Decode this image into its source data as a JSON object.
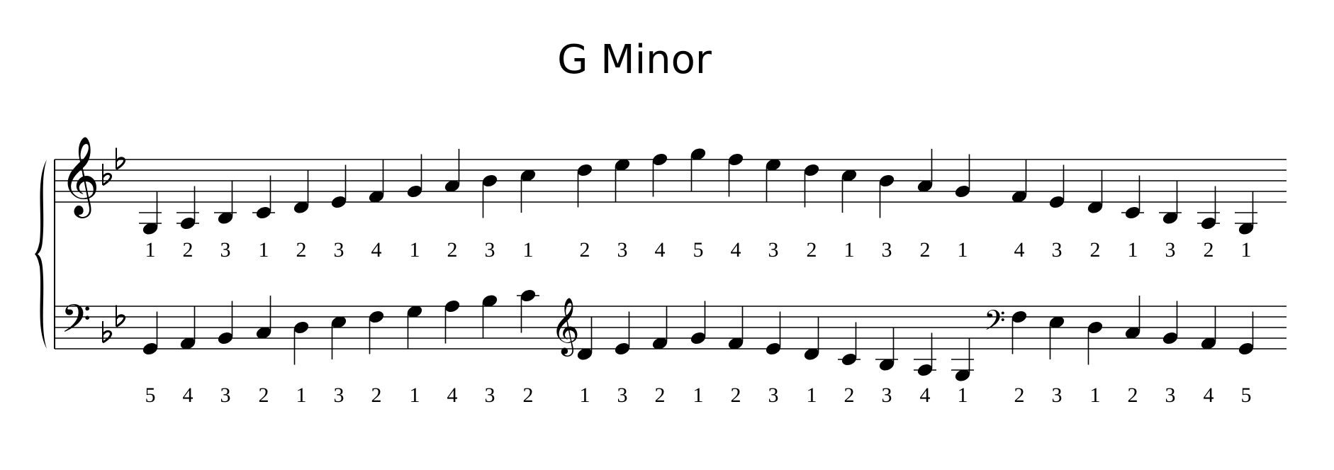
{
  "title": "G Minor",
  "key_signature": {
    "flats": [
      "B",
      "E"
    ],
    "label": "2 flats"
  },
  "colors": {
    "ink": "#000000",
    "paper": "#ffffff"
  },
  "staves": [
    {
      "name": "right-hand",
      "initial_clef": "treble",
      "clef_changes": [],
      "notes": [
        {
          "pitch": "G3",
          "finger": "1"
        },
        {
          "pitch": "A3",
          "finger": "2"
        },
        {
          "pitch": "Bb3",
          "finger": "3"
        },
        {
          "pitch": "C4",
          "finger": "1"
        },
        {
          "pitch": "D4",
          "finger": "2"
        },
        {
          "pitch": "Eb4",
          "finger": "3"
        },
        {
          "pitch": "F4",
          "finger": "4"
        },
        {
          "pitch": "G4",
          "finger": "1"
        },
        {
          "pitch": "A4",
          "finger": "2"
        },
        {
          "pitch": "Bb4",
          "finger": "3"
        },
        {
          "pitch": "C5",
          "finger": "1"
        },
        {
          "pitch": "D5",
          "finger": "2"
        },
        {
          "pitch": "Eb5",
          "finger": "3"
        },
        {
          "pitch": "F5",
          "finger": "4"
        },
        {
          "pitch": "G5",
          "finger": "5"
        },
        {
          "pitch": "F5",
          "finger": "4"
        },
        {
          "pitch": "Eb5",
          "finger": "3"
        },
        {
          "pitch": "D5",
          "finger": "2"
        },
        {
          "pitch": "C5",
          "finger": "1"
        },
        {
          "pitch": "Bb4",
          "finger": "3"
        },
        {
          "pitch": "A4",
          "finger": "2"
        },
        {
          "pitch": "G4",
          "finger": "1"
        },
        {
          "pitch": "F4",
          "finger": "4"
        },
        {
          "pitch": "Eb4",
          "finger": "3"
        },
        {
          "pitch": "D4",
          "finger": "2"
        },
        {
          "pitch": "C4",
          "finger": "1"
        },
        {
          "pitch": "Bb3",
          "finger": "3"
        },
        {
          "pitch": "A3",
          "finger": "2"
        },
        {
          "pitch": "G3",
          "finger": "1"
        }
      ]
    },
    {
      "name": "left-hand",
      "initial_clef": "bass",
      "clef_changes": [
        {
          "before_note": 11,
          "clef": "treble"
        },
        {
          "before_note": 22,
          "clef": "bass"
        }
      ],
      "notes": [
        {
          "pitch": "G2",
          "finger": "5"
        },
        {
          "pitch": "A2",
          "finger": "4"
        },
        {
          "pitch": "Bb2",
          "finger": "3"
        },
        {
          "pitch": "C3",
          "finger": "2"
        },
        {
          "pitch": "D3",
          "finger": "1"
        },
        {
          "pitch": "Eb3",
          "finger": "3"
        },
        {
          "pitch": "F3",
          "finger": "2"
        },
        {
          "pitch": "G3",
          "finger": "1"
        },
        {
          "pitch": "A3",
          "finger": "4"
        },
        {
          "pitch": "Bb3",
          "finger": "3"
        },
        {
          "pitch": "C4",
          "finger": "2"
        },
        {
          "pitch": "D4",
          "finger": "1"
        },
        {
          "pitch": "Eb4",
          "finger": "3"
        },
        {
          "pitch": "F4",
          "finger": "2"
        },
        {
          "pitch": "G4",
          "finger": "1"
        },
        {
          "pitch": "F4",
          "finger": "2"
        },
        {
          "pitch": "Eb4",
          "finger": "3"
        },
        {
          "pitch": "D4",
          "finger": "1"
        },
        {
          "pitch": "C4",
          "finger": "2"
        },
        {
          "pitch": "Bb3",
          "finger": "3"
        },
        {
          "pitch": "A3",
          "finger": "4"
        },
        {
          "pitch": "G3",
          "finger": "1"
        },
        {
          "pitch": "F3",
          "finger": "2"
        },
        {
          "pitch": "Eb3",
          "finger": "3"
        },
        {
          "pitch": "D3",
          "finger": "1"
        },
        {
          "pitch": "C3",
          "finger": "2"
        },
        {
          "pitch": "Bb2",
          "finger": "3"
        },
        {
          "pitch": "A2",
          "finger": "4"
        },
        {
          "pitch": "G2",
          "finger": "5"
        }
      ]
    }
  ]
}
